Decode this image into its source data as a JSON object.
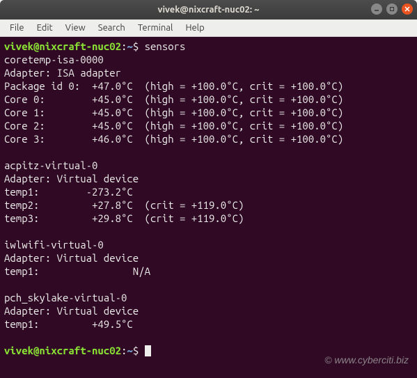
{
  "titlebar": {
    "title": "vivek@nixcraft-nuc02: ~"
  },
  "menubar": {
    "items": [
      "File",
      "Edit",
      "View",
      "Search",
      "Terminal",
      "Help"
    ]
  },
  "prompt": {
    "user_host": "vivek@nixcraft-nuc02",
    "separator": ":",
    "path": "~",
    "symbol": "$"
  },
  "command": "sensors",
  "output": {
    "sections": [
      {
        "header": "coretemp-isa-0000",
        "adapter": "Adapter: ISA adapter",
        "rows": [
          {
            "label": "Package id 0:",
            "temp": "+47.0°C",
            "extra": "(high = +100.0°C, crit = +100.0°C)"
          },
          {
            "label": "Core 0:",
            "temp": "+45.0°C",
            "extra": "(high = +100.0°C, crit = +100.0°C)"
          },
          {
            "label": "Core 1:",
            "temp": "+45.0°C",
            "extra": "(high = +100.0°C, crit = +100.0°C)"
          },
          {
            "label": "Core 2:",
            "temp": "+45.0°C",
            "extra": "(high = +100.0°C, crit = +100.0°C)"
          },
          {
            "label": "Core 3:",
            "temp": "+46.0°C",
            "extra": "(high = +100.0°C, crit = +100.0°C)"
          }
        ]
      },
      {
        "header": "acpitz-virtual-0",
        "adapter": "Adapter: Virtual device",
        "rows": [
          {
            "label": "temp1:",
            "temp": "-273.2°C",
            "extra": ""
          },
          {
            "label": "temp2:",
            "temp": "+27.8°C",
            "extra": "(crit = +119.0°C)"
          },
          {
            "label": "temp3:",
            "temp": "+29.8°C",
            "extra": "(crit = +119.0°C)"
          }
        ]
      },
      {
        "header": "iwlwifi-virtual-0",
        "adapter": "Adapter: Virtual device",
        "rows": [
          {
            "label": "temp1:",
            "temp": "N/A",
            "extra": "",
            "na": true
          }
        ]
      },
      {
        "header": "pch_skylake-virtual-0",
        "adapter": "Adapter: Virtual device",
        "rows": [
          {
            "label": "temp1:",
            "temp": "+49.5°C",
            "extra": ""
          }
        ]
      }
    ]
  },
  "watermark": "© www.cyberciti.biz"
}
